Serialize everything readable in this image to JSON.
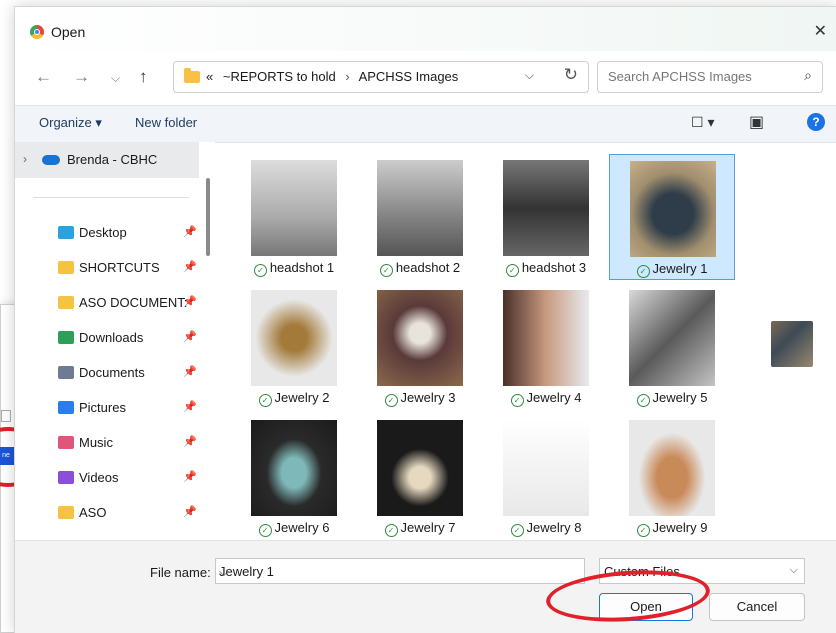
{
  "window": {
    "title": "Open"
  },
  "address": {
    "overflow": "«",
    "segments": [
      "~REPORTS to hold",
      "APCHSS Images"
    ],
    "separator": "›"
  },
  "search": {
    "placeholder": "Search APCHSS Images"
  },
  "commands": {
    "organize": "Organize ▾",
    "new_folder": "New folder"
  },
  "sidebar": {
    "top": "Brenda - CBHC",
    "items": [
      {
        "label": "Desktop",
        "icon": "desktop-icon",
        "color": "#29a3e0"
      },
      {
        "label": "SHORTCUTS",
        "icon": "folder-icon",
        "color": "#f5c242"
      },
      {
        "label": "ASO DOCUMENT:",
        "icon": "folder-icon",
        "color": "#f5c242"
      },
      {
        "label": "Downloads",
        "icon": "download-icon",
        "color": "#2e9e5b"
      },
      {
        "label": "Documents",
        "icon": "documents-icon",
        "color": "#6b7c93"
      },
      {
        "label": "Pictures",
        "icon": "pictures-icon",
        "color": "#2b7de9"
      },
      {
        "label": "Music",
        "icon": "music-icon",
        "color": "#e0567a"
      },
      {
        "label": "Videos",
        "icon": "videos-icon",
        "color": "#8a4fd6"
      },
      {
        "label": "ASO",
        "icon": "folder-icon",
        "color": "#f5c242"
      }
    ]
  },
  "files": [
    {
      "name": "headshot 1"
    },
    {
      "name": "headshot 2"
    },
    {
      "name": "headshot 3"
    },
    {
      "name": "Jewelry 1"
    },
    {
      "name": "Jewelry 2"
    },
    {
      "name": "Jewelry 3"
    },
    {
      "name": "Jewelry 4"
    },
    {
      "name": "Jewelry 5"
    },
    {
      "name": "Jewelry 6"
    },
    {
      "name": "Jewelry 7"
    },
    {
      "name": "Jewelry 8"
    },
    {
      "name": "Jewelry 9"
    }
  ],
  "selected_file": "Jewelry 1",
  "bottom": {
    "file_name_label": "File name:",
    "file_name_value": "Jewelry 1",
    "file_type": "Custom Files",
    "open": "Open",
    "cancel": "Cancel"
  },
  "background_window": {
    "button_text": "ne"
  },
  "colors": {
    "accent": "#1a73e8",
    "annotation": "#e0202a",
    "selection": "#cde8ff"
  }
}
